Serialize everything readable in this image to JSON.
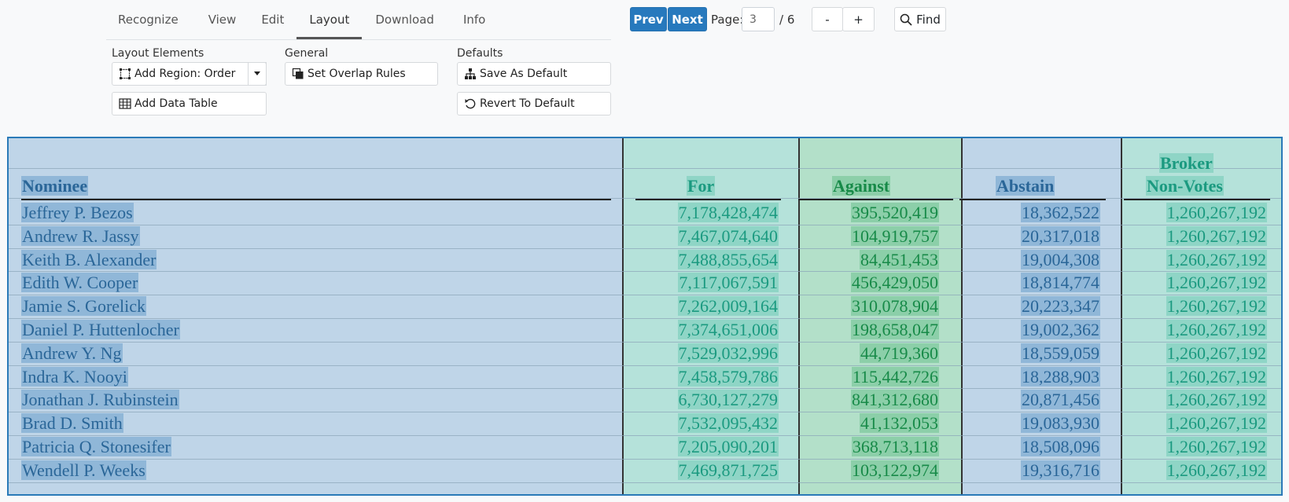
{
  "tabs": [
    {
      "label": "Recognize",
      "active": false
    },
    {
      "label": "View",
      "active": false
    },
    {
      "label": "Edit",
      "active": false
    },
    {
      "label": "Layout",
      "active": true
    },
    {
      "label": "Download",
      "active": false
    },
    {
      "label": "Info",
      "active": false
    }
  ],
  "ribbon": {
    "layout_elements": {
      "label": "Layout Elements",
      "add_region": "Add Region: Order",
      "add_table": "Add Data Table"
    },
    "general": {
      "label": "General",
      "overlap": "Set Overlap Rules"
    },
    "defaults": {
      "label": "Defaults",
      "save": "Save As Default",
      "revert": "Revert To Default"
    }
  },
  "pager": {
    "prev": "Prev",
    "next": "Next",
    "page_label": "Page:",
    "page_value": "3",
    "total": "/ 6",
    "zoom_out": "-",
    "zoom_in": "+",
    "find": "Find"
  },
  "colors": {
    "accent": "#2779bd",
    "nominee_region": "#bfd5e8",
    "for_region": "#b5e2da",
    "against_region": "#b3e0c9"
  },
  "table": {
    "headers": {
      "nominee": "Nominee",
      "for": "For",
      "against": "Against",
      "abstain": "Abstain",
      "broker_line1": "Broker",
      "broker_line2": "Non-Votes"
    },
    "rows": [
      {
        "name": "Jeffrey P. Bezos",
        "for": "7,178,428,474",
        "against": "395,520,419",
        "abstain": "18,362,522",
        "broker": "1,260,267,192"
      },
      {
        "name": "Andrew R. Jassy",
        "for": "7,467,074,640",
        "against": "104,919,757",
        "abstain": "20,317,018",
        "broker": "1,260,267,192"
      },
      {
        "name": "Keith B. Alexander",
        "for": "7,488,855,654",
        "against": "84,451,453",
        "abstain": "19,004,308",
        "broker": "1,260,267,192"
      },
      {
        "name": "Edith W. Cooper",
        "for": "7,117,067,591",
        "against": "456,429,050",
        "abstain": "18,814,774",
        "broker": "1,260,267,192"
      },
      {
        "name": "Jamie S. Gorelick",
        "for": "7,262,009,164",
        "against": "310,078,904",
        "abstain": "20,223,347",
        "broker": "1,260,267,192"
      },
      {
        "name": "Daniel P. Huttenlocher",
        "for": "7,374,651,006",
        "against": "198,658,047",
        "abstain": "19,002,362",
        "broker": "1,260,267,192"
      },
      {
        "name": "Andrew Y. Ng",
        "for": "7,529,032,996",
        "against": "44,719,360",
        "abstain": "18,559,059",
        "broker": "1,260,267,192"
      },
      {
        "name": "Indra K. Nooyi",
        "for": "7,458,579,786",
        "against": "115,442,726",
        "abstain": "18,288,903",
        "broker": "1,260,267,192"
      },
      {
        "name": "Jonathan J. Rubinstein",
        "for": "6,730,127,279",
        "against": "841,312,680",
        "abstain": "20,871,456",
        "broker": "1,260,267,192"
      },
      {
        "name": "Brad D. Smith",
        "for": "7,532,095,432",
        "against": "41,132,053",
        "abstain": "19,083,930",
        "broker": "1,260,267,192"
      },
      {
        "name": "Patricia Q. Stonesifer",
        "for": "7,205,090,201",
        "against": "368,713,118",
        "abstain": "18,508,096",
        "broker": "1,260,267,192"
      },
      {
        "name": "Wendell P. Weeks",
        "for": "7,469,871,725",
        "against": "103,122,974",
        "abstain": "19,316,716",
        "broker": "1,260,267,192"
      }
    ]
  }
}
